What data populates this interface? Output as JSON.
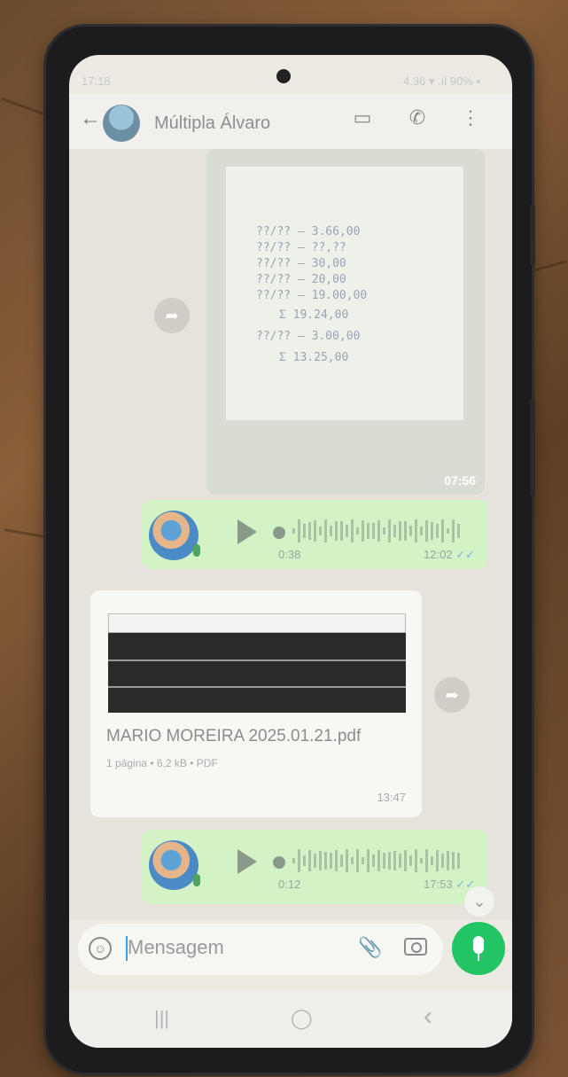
{
  "status": {
    "time": "17:18",
    "right": "4.36 ▾ .ıl 90% ▪"
  },
  "chat_header": {
    "contact_name": "Múltipla Álvaro"
  },
  "image_message": {
    "time": "07:56",
    "paper_lines": [
      "??/?? — 3.66,00",
      "??/?? — ??,??",
      "??/?? — 30,00",
      "??/?? — 20,00",
      "??/?? — 19.00,00",
      "Σ 19.24,00",
      "??/?? — 3.00,00",
      "Σ 13.25,00"
    ]
  },
  "voice_message_1": {
    "duration": "0:38",
    "time": "12:02",
    "ticks": "✓✓"
  },
  "document_message": {
    "file_name": "MARIO MOREIRA 2025.01.21.pdf",
    "meta": "1 página • 6,2 kB • PDF",
    "time": "13:47"
  },
  "voice_message_2": {
    "duration": "0:12",
    "time": "17:53",
    "ticks": "✓✓"
  },
  "composer": {
    "placeholder": "Mensagem"
  },
  "navbar": {
    "recent": "|||",
    "home": "◯",
    "back": "‹"
  }
}
